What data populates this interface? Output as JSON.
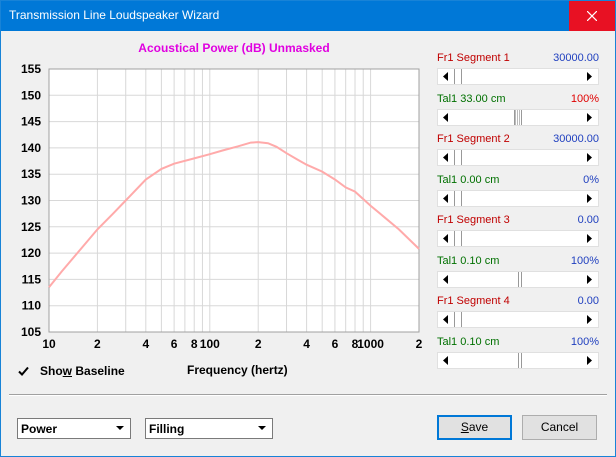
{
  "window": {
    "title": "Transmission Line Loudspeaker Wizard",
    "close_icon": "close-icon"
  },
  "chart_data": {
    "type": "line",
    "title": "Acoustical Power (dB)",
    "subtitle": "Unmasked",
    "xlabel": "Frequency (hertz)",
    "ylabel": "",
    "x_scale": "log",
    "xlim": [
      10,
      2000
    ],
    "ylim": [
      105,
      155
    ],
    "grid": true,
    "y_ticks": [
      "155",
      "150",
      "145",
      "140",
      "135",
      "130",
      "125",
      "120",
      "115",
      "110",
      "105"
    ],
    "x_tick_labels": [
      "10",
      "2",
      "4",
      "6",
      "8",
      "100",
      "2",
      "4",
      "6",
      "8",
      "1000",
      "2"
    ],
    "series": [
      {
        "color": "#ffaaaa",
        "x": [
          10,
          12,
          15,
          20,
          25,
          30,
          40,
          50,
          60,
          80,
          100,
          120,
          150,
          180,
          200,
          230,
          260,
          300,
          350,
          400,
          500,
          600,
          700,
          800,
          1000,
          1200,
          1500,
          2000
        ],
        "y": [
          113.5,
          116.5,
          120,
          124.5,
          127.5,
          130,
          134,
          136,
          137,
          138,
          138.8,
          139.5,
          140.3,
          141,
          141.1,
          140.9,
          140.2,
          139,
          137.8,
          136.8,
          135.5,
          134,
          132.5,
          131.7,
          129,
          127,
          124.5,
          120.8
        ]
      }
    ]
  },
  "show_baseline": {
    "label_pre": "Sho",
    "label_ul": "w",
    "label_post": " Baseline",
    "checked": true
  },
  "segments": [
    {
      "name": "Fr1  Segment 1",
      "value": "30000.00",
      "tal": "Tal1  33.00 cm",
      "tal_pct": "100%"
    },
    {
      "name": "Fr1  Segment 2",
      "value": "30000.00",
      "tal": "Tal1  0.00 cm",
      "tal_pct": "0%"
    },
    {
      "name": "Fr1  Segment 3",
      "value": "0.00",
      "tal": "Tal1  0.10 cm",
      "tal_pct": "100%"
    },
    {
      "name": "Fr1  Segment 4",
      "value": "0.00",
      "tal": "Tal1  0.10 cm",
      "tal_pct": "100%"
    }
  ],
  "dropdowns": {
    "mode": "Power",
    "filling": "Filling"
  },
  "buttons": {
    "save_pre": "",
    "save_ul": "S",
    "save_post": "ave",
    "cancel": "Cancel"
  }
}
